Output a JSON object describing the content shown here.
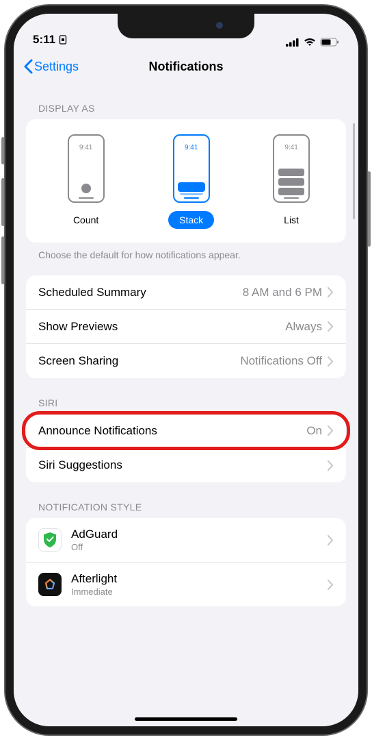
{
  "status": {
    "time": "5:11",
    "signal": 4,
    "wifi": 3
  },
  "nav": {
    "back": "Settings",
    "title": "Notifications"
  },
  "display": {
    "header": "DISPLAY AS",
    "preview_time": "9:41",
    "options": [
      {
        "label": "Count"
      },
      {
        "label": "Stack"
      },
      {
        "label": "List"
      }
    ],
    "footer": "Choose the default for how notifications appear."
  },
  "settings": {
    "rows": [
      {
        "label": "Scheduled Summary",
        "value": "8 AM and 6 PM"
      },
      {
        "label": "Show Previews",
        "value": "Always"
      },
      {
        "label": "Screen Sharing",
        "value": "Notifications Off"
      }
    ]
  },
  "siri": {
    "header": "SIRI",
    "rows": [
      {
        "label": "Announce Notifications",
        "value": "On"
      },
      {
        "label": "Siri Suggestions",
        "value": ""
      }
    ]
  },
  "style": {
    "header": "NOTIFICATION STYLE",
    "apps": [
      {
        "name": "AdGuard",
        "sub": "Off"
      },
      {
        "name": "Afterlight",
        "sub": "Immediate"
      }
    ]
  }
}
